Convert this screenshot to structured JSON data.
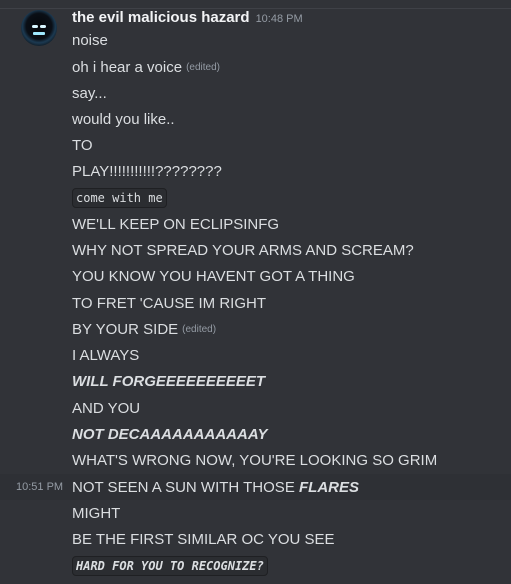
{
  "header": {
    "username": "the evil malicious hazard",
    "timestamp": "10:48 PM"
  },
  "messages": [
    {
      "text": "noise"
    },
    {
      "text": "oh i hear a voice",
      "edited": "(edited)"
    },
    {
      "text": "say..."
    },
    {
      "text": "would you like.."
    },
    {
      "text": "TO"
    },
    {
      "text": "PLAY!!!!!!!!!!!????????"
    },
    {
      "code": "come with me"
    },
    {
      "text": "WE'LL KEEP ON ECLIPSINFG"
    },
    {
      "text": "WHY NOT SPREAD YOUR ARMS AND SCREAM?"
    },
    {
      "text": "YOU KNOW YOU HAVENT GOT A THING"
    },
    {
      "text": "TO FRET 'CAUSE IM RIGHT"
    },
    {
      "text": "BY YOUR SIDE",
      "edited": "(edited)"
    },
    {
      "text": "I ALWAYS"
    },
    {
      "bold_italic": "WILL FORGEEEEEEEEEET"
    },
    {
      "text": "AND YOU"
    },
    {
      "bold_italic": "NOT DECAAAAAAAAAAAY"
    },
    {
      "text": "WHAT'S WRONG NOW, YOU'RE LOOKING SO GRIM"
    },
    {
      "text": "NOT SEEN A SUN WITH THOSE ",
      "bold_italic": "FLARES",
      "gutter_time": "10:51 PM",
      "hovered": true
    },
    {
      "text": "MIGHT"
    },
    {
      "text": "BE THE FIRST SIMILAR OC YOU SEE"
    },
    {
      "code_bold_italic": "HARD FOR YOU TO RECOGNIZE?"
    }
  ]
}
